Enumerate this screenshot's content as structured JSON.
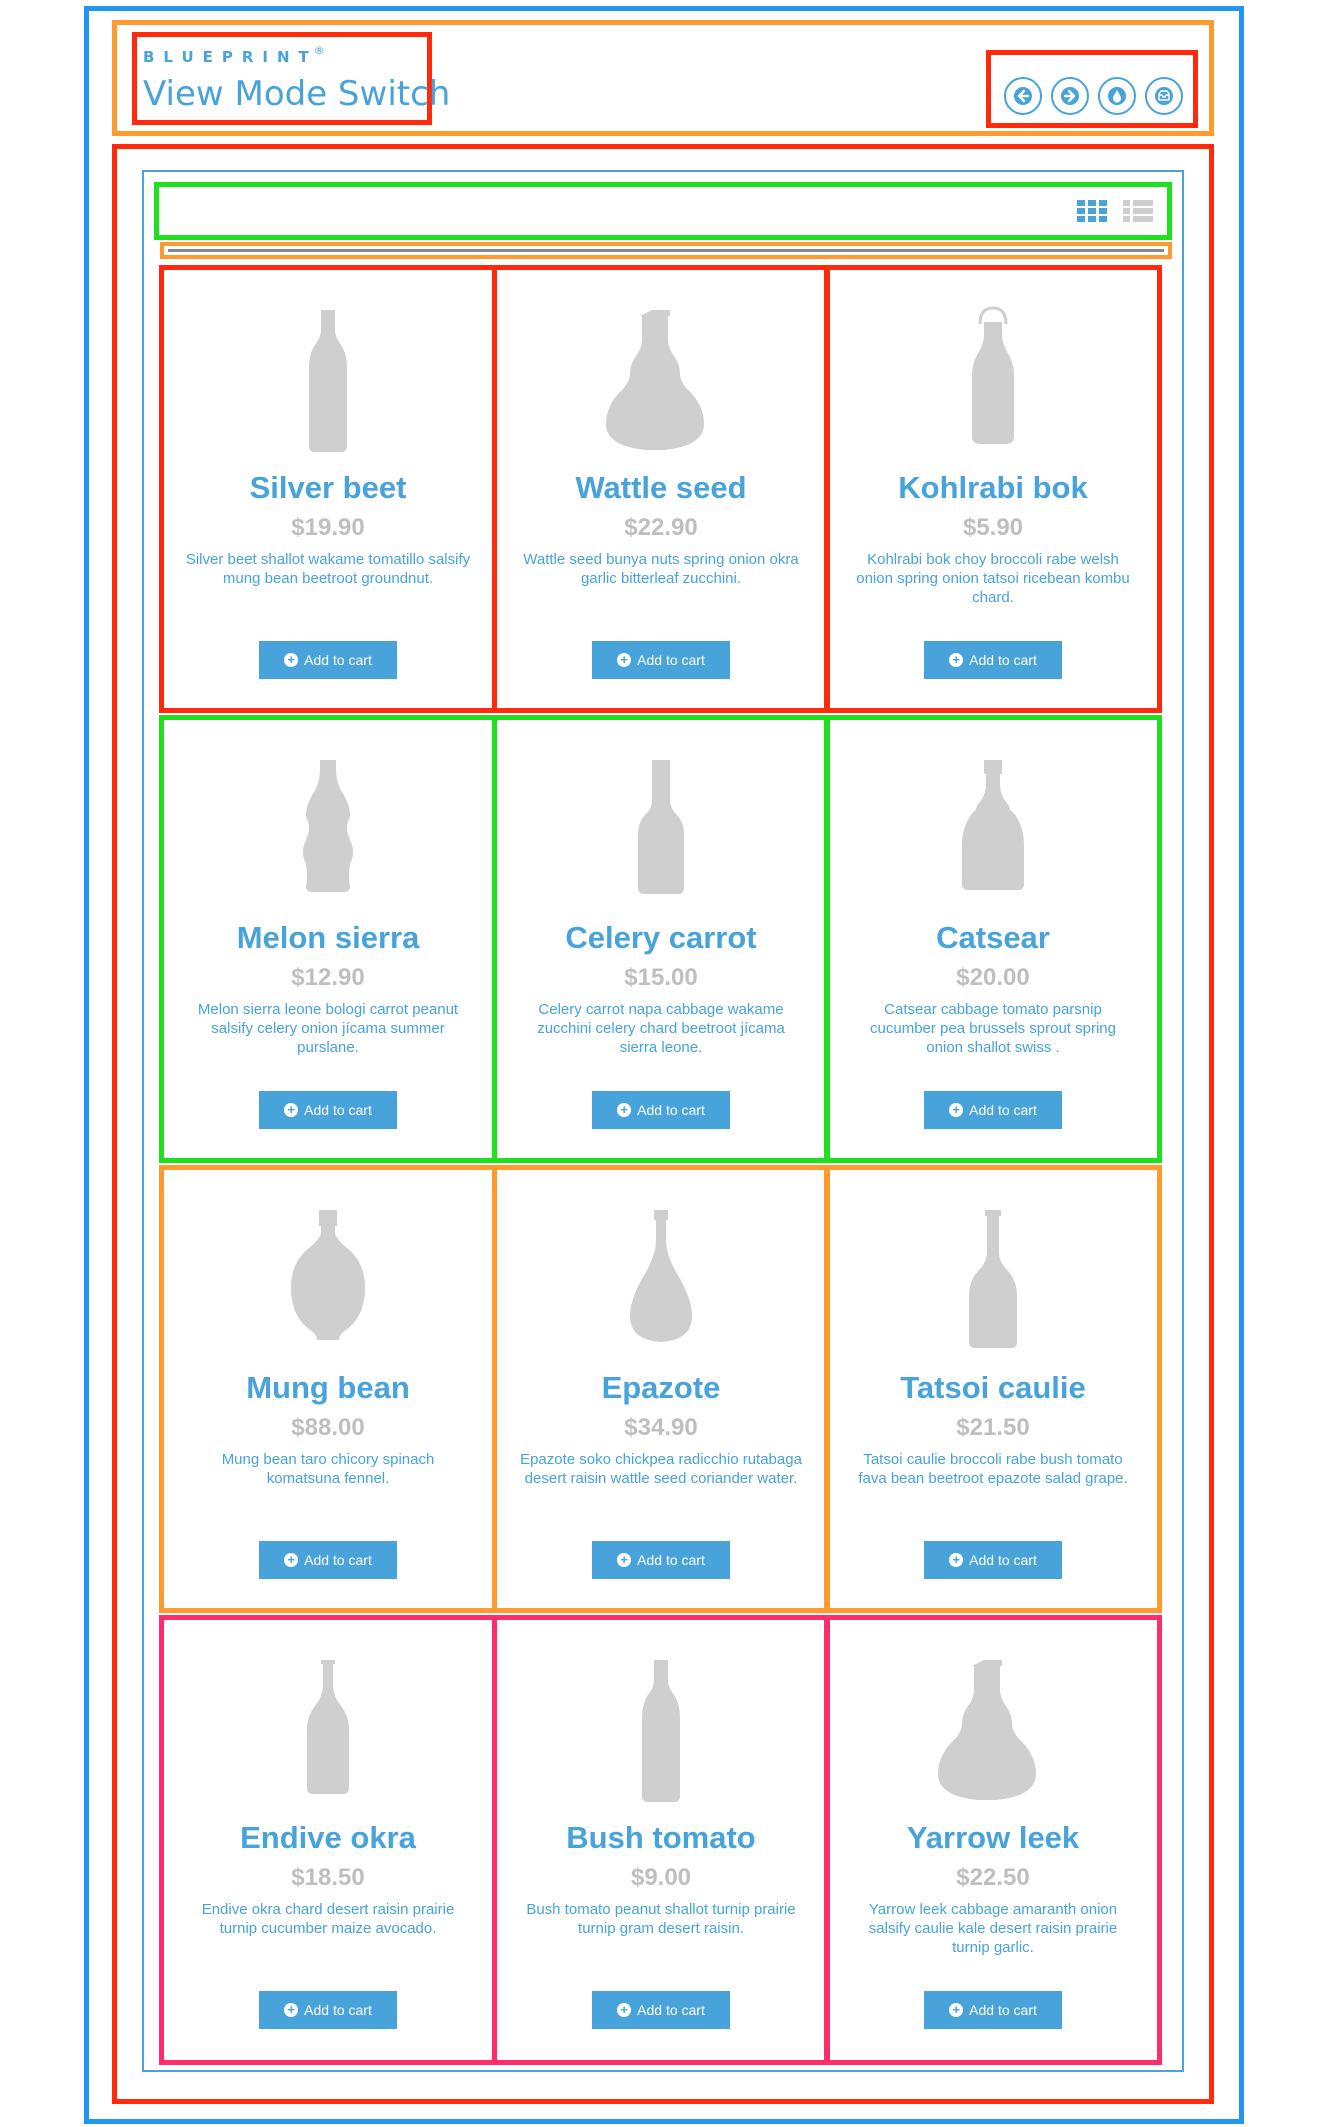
{
  "header": {
    "brand": "BLUEPRINT",
    "brand_mark": "®",
    "title": "View Mode Switch",
    "nav_icons": [
      "arrow-left-icon",
      "arrow-right-icon",
      "drop-icon",
      "inbox-icon"
    ]
  },
  "toolbar": {
    "view_icons": [
      "grid-view-icon",
      "list-view-icon"
    ]
  },
  "colors": {
    "accent": "#47a3da",
    "price": "#bfbfbf",
    "bottle": "#cfcfcf"
  },
  "products": [
    {
      "name": "Silver beet",
      "price": "$19.90",
      "description": "Silver beet shallot wakame tomatillo salsify mung bean beetroot groundnut.",
      "button": "Add to cart",
      "bottle": "slim"
    },
    {
      "name": "Wattle seed",
      "price": "$22.90",
      "description": "Wattle seed bunya nuts spring onion okra garlic bitterleaf zucchini.",
      "button": "Add to cart",
      "bottle": "wide"
    },
    {
      "name": "Kohlrabi bok",
      "price": "$5.90",
      "description": "Kohlrabi bok choy broccoli rabe welsh onion spring onion tatsoi ricebean kombu chard.",
      "button": "Add to cart",
      "bottle": "swingtop"
    },
    {
      "name": "Melon sierra",
      "price": "$12.90",
      "description": "Melon sierra leone bologi carrot peanut salsify celery onion jícama summer purslane.",
      "button": "Add to cart",
      "bottle": "soda"
    },
    {
      "name": "Celery carrot",
      "price": "$15.00",
      "description": "Celery carrot napa cabbage wakame zucchini celery chard beetroot jícama sierra leone.",
      "button": "Add to cart",
      "bottle": "square"
    },
    {
      "name": "Catsear",
      "price": "$20.00",
      "description": "Catsear cabbage tomato parsnip cucumber pea brussels sprout spring onion shallot swiss .",
      "button": "Add to cart",
      "bottle": "whisky"
    },
    {
      "name": "Mung bean",
      "price": "$88.00",
      "description": "Mung bean taro chicory spinach komatsuna fennel.",
      "button": "Add to cart",
      "bottle": "round"
    },
    {
      "name": "Epazote",
      "price": "$34.90",
      "description": "Epazote soko chickpea radicchio rutabaga desert raisin wattle seed coriander water.",
      "button": "Add to cart",
      "bottle": "teardrop"
    },
    {
      "name": "Tatsoi caulie",
      "price": "$21.50",
      "description": "Tatsoi caulie broccoli rabe bush tomato fava bean beetroot epazote salad grape.",
      "button": "Add to cart",
      "bottle": "wine"
    },
    {
      "name": "Endive okra",
      "price": "$18.50",
      "description": "Endive okra chard desert raisin prairie turnip cucumber maize avocado.",
      "button": "Add to cart",
      "bottle": "beer"
    },
    {
      "name": "Bush tomato",
      "price": "$9.00",
      "description": "Bush tomato peanut shallot turnip prairie turnip gram desert raisin.",
      "button": "Add to cart",
      "bottle": "slim"
    },
    {
      "name": "Yarrow leek",
      "price": "$22.50",
      "description": "Yarrow leek cabbage amaranth onion salsify caulie kale desert raisin prairie turnip garlic.",
      "button": "Add to cart",
      "bottle": "wide"
    }
  ]
}
